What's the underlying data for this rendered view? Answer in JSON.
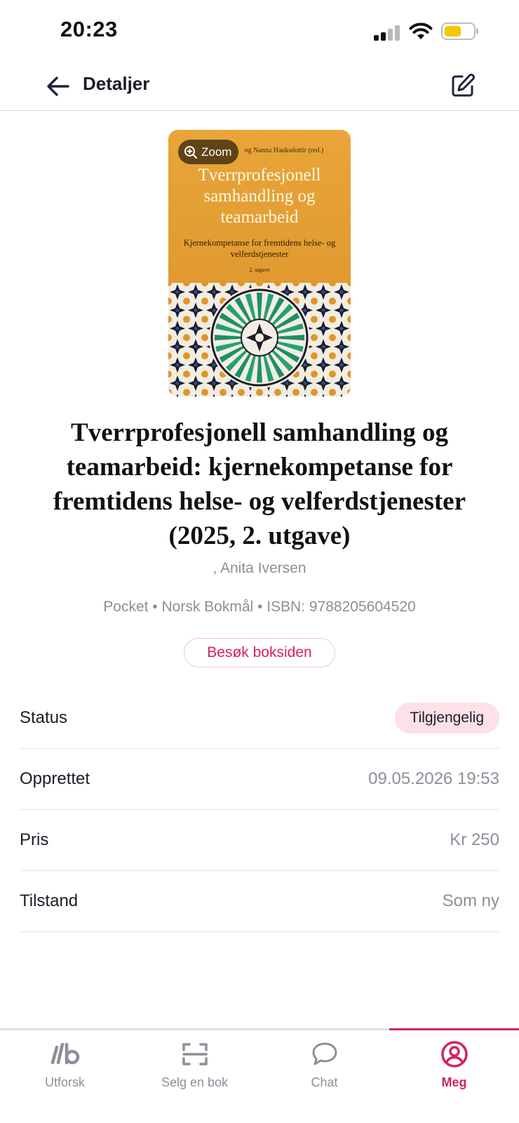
{
  "status_bar": {
    "time": "20:23"
  },
  "header": {
    "title": "Detaljer",
    "back_icon": "arrow-left-icon",
    "edit_icon": "edit-icon"
  },
  "cover": {
    "zoom_label": "Zoom",
    "authors_text": "og Nanna Hauksdottir (red.)",
    "title_text": "Tverrprofesjonell samhandling og teamarbeid",
    "subtitle_text": "Kjernekompetanse for fremtidens helse- og velferdstjenester",
    "edition_text": "2. utgave"
  },
  "book": {
    "title": "Tverrprofesjonell samhandling og teamarbeid: kjernekompetanse for fremtidens helse- og velferdstjenester (2025, 2. utgave)",
    "author": ", Anita Iversen",
    "meta": "Pocket • Norsk Bokmål • ISBN: 9788205604520",
    "visit_button": "Besøk boksiden"
  },
  "details": [
    {
      "label": "Status",
      "value": "Tilgjengelig"
    },
    {
      "label": "Opprettet",
      "value": "09.05.2026 19:53"
    },
    {
      "label": "Pris",
      "value": "Kr 250"
    },
    {
      "label": "Tilstand",
      "value": "Som ny"
    }
  ],
  "tabs": [
    {
      "label": "Utforsk",
      "icon": "lb-logo-icon"
    },
    {
      "label": "Selg en bok",
      "icon": "scan-icon"
    },
    {
      "label": "Chat",
      "icon": "chat-bubble-icon"
    },
    {
      "label": "Meg",
      "icon": "user-circle-icon",
      "active": true
    }
  ],
  "colors": {
    "accent": "#d2245a",
    "badge_bg": "#fde0e8",
    "muted_text": "#8b8f99",
    "divider": "#f5dce2",
    "cover_orange": "#e4a035"
  }
}
